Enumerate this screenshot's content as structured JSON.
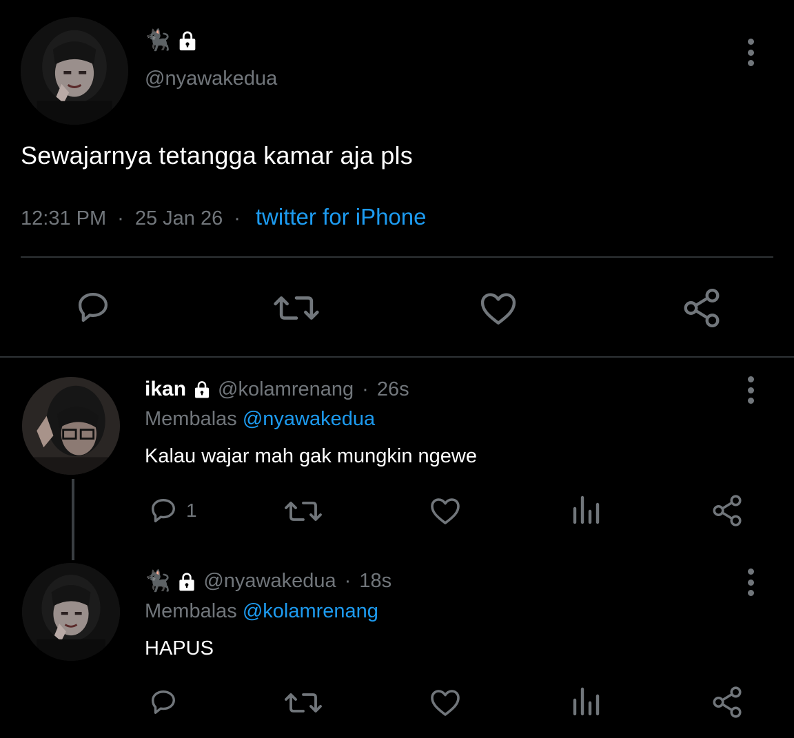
{
  "main_tweet": {
    "emoji": "🐈‍⬛",
    "handle": "@nyawakedua",
    "text": "Sewajarnya tetangga kamar aja pls",
    "time": "12:31 PM",
    "date": "25 Jan 26",
    "client": "twitter for iPhone",
    "icons": [
      "reply-icon",
      "retweet-icon",
      "like-icon",
      "share-icon"
    ]
  },
  "replies": [
    {
      "name": "ikan",
      "handle": "@kolamrenang",
      "time": "26s",
      "replying_label": "Membalas",
      "replying_to": "@nyawakedua",
      "text": "Kalau wajar mah gak mungkin ngewe",
      "reply_count": "1"
    },
    {
      "emoji": "🐈‍⬛",
      "handle": "@nyawakedua",
      "time": "18s",
      "replying_label": "Membalas",
      "replying_to": "@kolamrenang",
      "text": "HAPUS",
      "reply_count": ""
    }
  ],
  "colors": {
    "background": "#000000",
    "text": "#ffffff",
    "secondary": "#71767b",
    "link": "#1d9bf0",
    "divider": "#2f3336"
  },
  "separator": "·"
}
